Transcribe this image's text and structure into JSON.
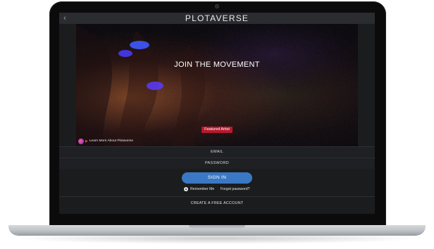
{
  "app": {
    "brand": "PLOTAVERSE"
  },
  "hero": {
    "title": "JOIN THE MOVEMENT",
    "featured_badge": "Featured Artist",
    "learn_more": "Learn More About Plotaverse"
  },
  "form": {
    "email_label": "EMAIL",
    "password_label": "PASSWORD",
    "signin_label": "SIGN IN",
    "remember_label": "Remember Me",
    "forgot_label": "Forgot password?",
    "create_label": "CREATE A FREE ACCOUNT"
  },
  "colors": {
    "accent": "#3b78c4",
    "badge": "#b8192e",
    "screen_bg": "#1b1c1e"
  },
  "icons": {
    "back": "chevron-left-icon",
    "camera": "camera-icon",
    "learn_more": "info-icon"
  }
}
